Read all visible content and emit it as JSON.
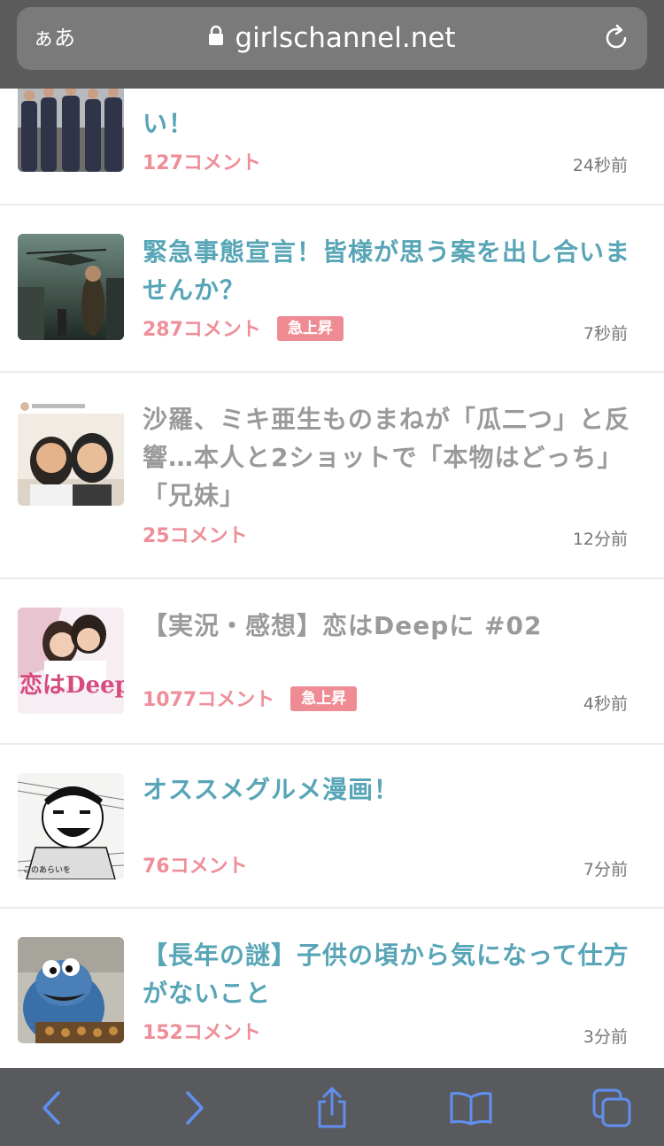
{
  "browser": {
    "text_size_label": "ぁあ",
    "url": "girlschannel.net"
  },
  "topics": [
    {
      "title": "オシャレな男性のファッションが見たい！",
      "title_visible_tail": "い！",
      "comments": "127コメント",
      "badge": "",
      "time": "24秒前",
      "read": false,
      "thumb": "men-in-suits-photo"
    },
    {
      "title": "緊急事態宣言！皆様が思う案を出し合いませんか？",
      "comments": "287コメント",
      "badge": "急上昇",
      "time": "7秒前",
      "read": false,
      "thumb": "movie-poster-helicopter"
    },
    {
      "title": "沙羅、ミキ亜生ものまねが「瓜二つ」と反響…本人と2ショットで「本物はどっち」「兄妹」",
      "comments": "25コメント",
      "badge": "",
      "time": "12分前",
      "read": true,
      "thumb": "two-people-selfie"
    },
    {
      "title": "【実況・感想】恋はDeepに #02",
      "comments": "1077コメント",
      "badge": "急上昇",
      "time": "4秒前",
      "read": true,
      "thumb": "drama-poster-deep",
      "thumb_text": "恋はDeep"
    },
    {
      "title": "オススメグルメ漫画！",
      "comments": "76コメント",
      "badge": "",
      "time": "7分前",
      "read": false,
      "thumb": "manga-panel",
      "thumb_text": "このあらいを"
    },
    {
      "title": "【長年の謎】子供の頃から気になって仕方がないこと",
      "comments": "152コメント",
      "badge": "",
      "time": "3分前",
      "read": false,
      "thumb": "cookie-monster-photo"
    }
  ],
  "colors": {
    "link": "#57a5b6",
    "read": "#9a9a9a",
    "comment": "#ef8e99",
    "badge": "#ef8c93",
    "toolbar_icon": "#5f8ff0"
  },
  "toolbar": {
    "icons": [
      "back-icon",
      "forward-icon",
      "share-icon",
      "bookmarks-icon",
      "tabs-icon"
    ]
  }
}
